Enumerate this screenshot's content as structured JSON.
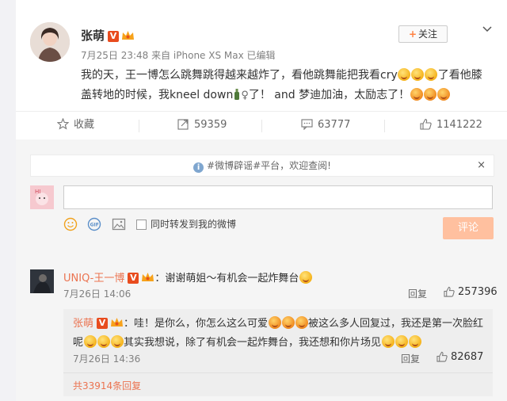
{
  "post": {
    "username": "张萌",
    "verified_badge": "V",
    "meta": "7月25日 23:48 来自 iPhone XS Max  已编辑",
    "follow_label": "关注",
    "text_parts": [
      "我的天，王一博怎么跳舞跳得越来越炸了，看他跳舞能把我看cry",
      "了看他膝盖转地的时候，我kneel down",
      "了！ and 梦迪加油，太励志了！"
    ]
  },
  "actions": {
    "favorite": "收藏",
    "forward_count": "59359",
    "comment_count": "63777",
    "like_count": "1141222"
  },
  "notice": {
    "text": "#微博辟谣#平台，欢迎查阅!",
    "close": "×"
  },
  "composer": {
    "forward_label": "同时转发到我的微博",
    "submit_label": "评论"
  },
  "comment": {
    "username": "UNIQ-王一博",
    "verified_badge": "V",
    "text": "：谢谢萌姐～有机会一起炸舞台",
    "time": "7月26日 14:06",
    "reply": "回复",
    "likes": "257396"
  },
  "sub_comment": {
    "username": "张萌",
    "verified_badge": "V",
    "text_parts": [
      "：哇！是你么，你怎么这么可爱",
      "被这么多人回复过，我还是第一次脸红呢",
      "其实我想说，除了有机会一起炸舞台，我还想和你片场见"
    ],
    "time": "7月26日 14:36",
    "reply": "回复",
    "likes": "82687"
  },
  "total_replies": "共33914条回复",
  "colors": {
    "accent": "#eb7350",
    "verified": "#e84c1e",
    "submit": "#ffc09f"
  },
  "icons": [
    "chevron-down-icon",
    "star-icon",
    "forward-icon",
    "comment-icon",
    "like-icon",
    "info-icon",
    "emoji-icon",
    "gif-icon",
    "image-icon"
  ]
}
